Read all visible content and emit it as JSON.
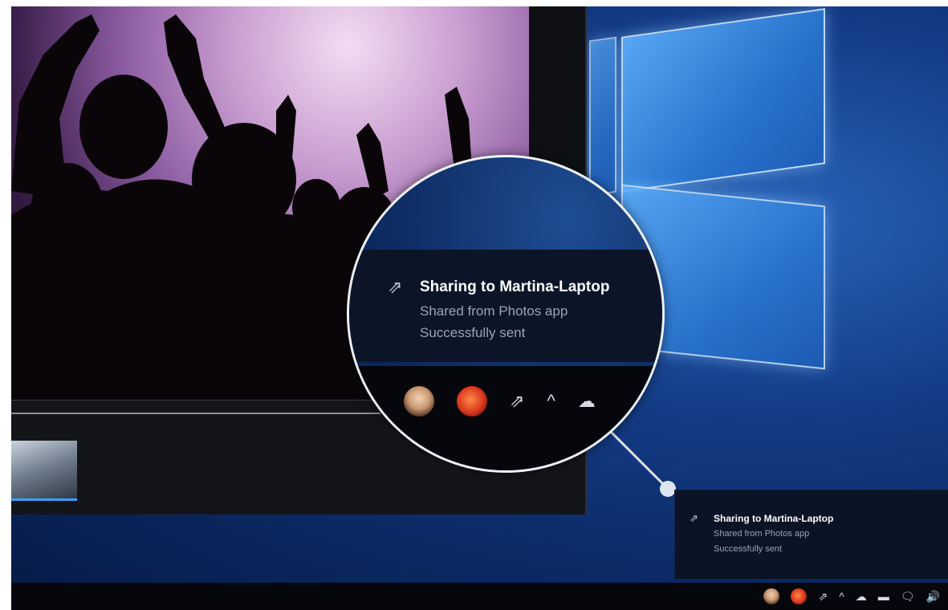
{
  "notification": {
    "title": "Sharing to Martina-Laptop",
    "source": "Shared from Photos app",
    "status": "Successfully sent"
  },
  "icons": {
    "share": "share-icon",
    "chevron": "chevron-up-icon",
    "cloud": "onedrive-cloud-icon",
    "network": "network-icon",
    "action_center": "action-center-icon",
    "volume": "volume-icon"
  },
  "glyphs": {
    "share": "⇗",
    "chevron": "^",
    "cloud": "☁",
    "network": "▬",
    "action_center": "🗨",
    "volume": "🔊"
  },
  "colors": {
    "desktop": "#0b2a66",
    "toast_bg": "#0a1426",
    "taskbar": "#05070d",
    "accent": "#3aa0ff"
  }
}
